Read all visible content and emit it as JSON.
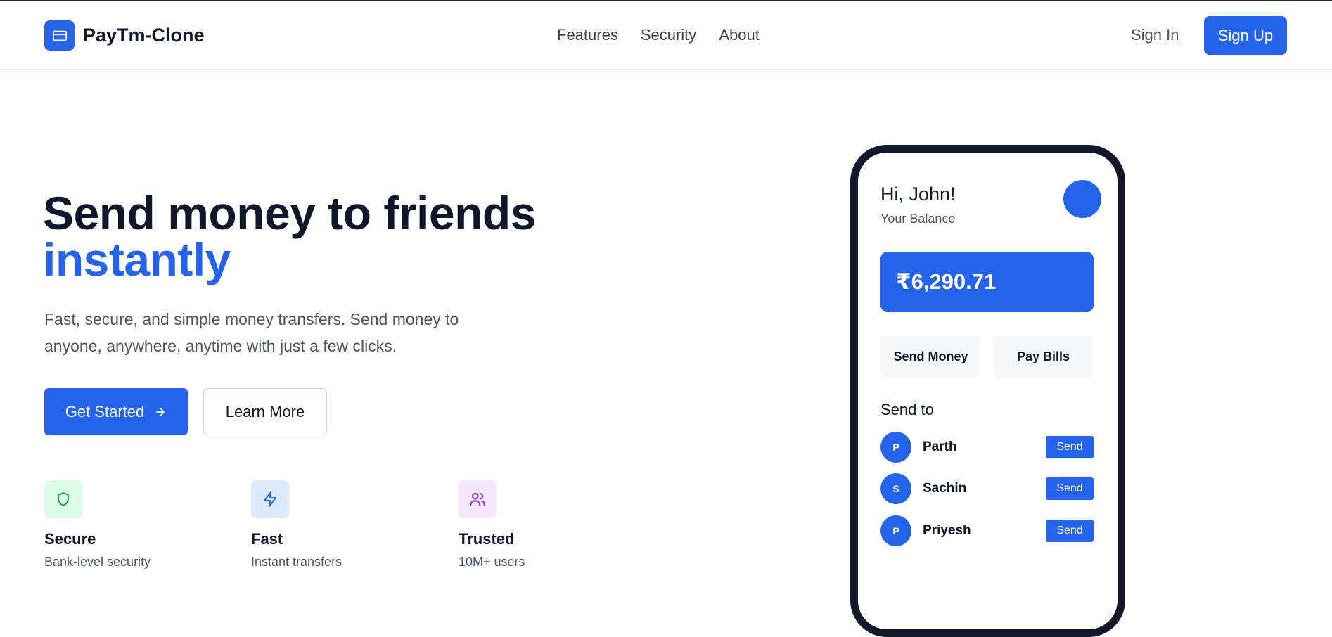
{
  "header": {
    "brand": "PayTm-Clone",
    "nav": [
      "Features",
      "Security",
      "About"
    ],
    "sign_in": "Sign In",
    "sign_up": "Sign Up"
  },
  "hero": {
    "title_line1": "Send money to friends",
    "title_line2": "instantly",
    "description": "Fast, secure, and simple money transfers. Send money to anyone, anywhere, anytime with just a few clicks.",
    "primary_button": "Get Started",
    "secondary_button": "Learn More"
  },
  "features": [
    {
      "icon": "shield-icon",
      "title": "Secure",
      "subtitle": "Bank-level security"
    },
    {
      "icon": "lightning-icon",
      "title": "Fast",
      "subtitle": "Instant transfers"
    },
    {
      "icon": "users-icon",
      "title": "Trusted",
      "subtitle": "10M+ users"
    }
  ],
  "phone": {
    "greeting": "Hi, John!",
    "balance_label": "Your Balance",
    "balance": "₹6,290.71",
    "actions": [
      "Send Money",
      "Pay Bills"
    ],
    "send_to_title": "Send to",
    "contacts": [
      {
        "initial": "P",
        "name": "Parth",
        "button": "Send"
      },
      {
        "initial": "S",
        "name": "Sachin",
        "button": "Send"
      },
      {
        "initial": "P",
        "name": "Priyesh",
        "button": "Send"
      }
    ]
  },
  "colors": {
    "accent": "#2563eb",
    "text": "#0f172a",
    "muted": "#4b5563"
  }
}
